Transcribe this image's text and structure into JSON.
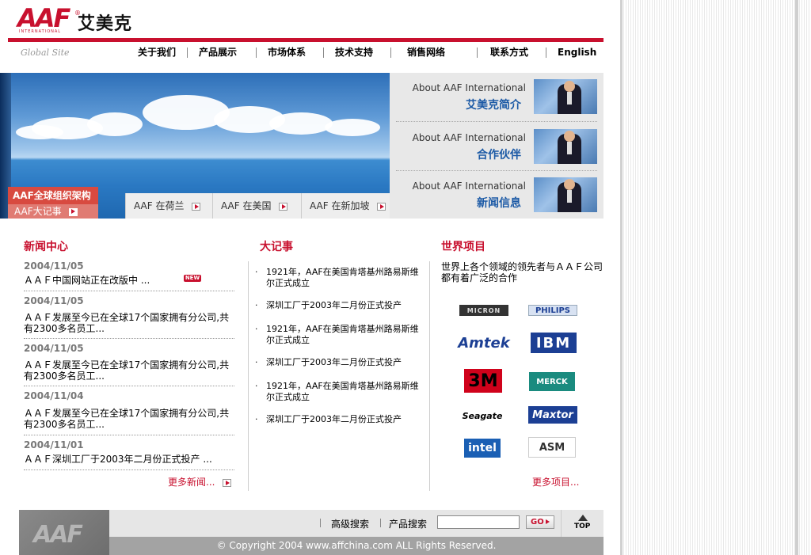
{
  "header": {
    "logo_text": "AAF",
    "logo_sub": "INTERNATIONAL",
    "logo_reg": "®",
    "brand_cn": "艾美克",
    "global_site": "Global Site"
  },
  "nav": [
    "关于我们",
    "产品展示",
    "市场体系",
    "技术支持",
    "销售网络",
    "联系方式",
    "English"
  ],
  "banner": {
    "caption_org": "AAF全球组织架构",
    "caption_events": "AAF大记事",
    "tabs": [
      "AAF 在荷兰",
      "AAF 在美国",
      "AAF 在新加坡"
    ],
    "side_items": [
      {
        "en": "About AAF International",
        "cn": "艾美克简介"
      },
      {
        "en": "About AAF International",
        "cn": "合作伙伴"
      },
      {
        "en": "About AAF International",
        "cn": "新闻信息"
      }
    ]
  },
  "news": {
    "title": "新闻中心",
    "badge": "NEW",
    "items": [
      {
        "date": "2004/11/05",
        "text": "ＡＡＦ中国网站正在改版中 ..."
      },
      {
        "date": "2004/11/05",
        "text": "ＡＡＦ发展至今已在全球17个国家拥有分公司,共有2300多名员工..."
      },
      {
        "date": "2004/11/05",
        "text": "ＡＡＦ发展至今已在全球17个国家拥有分公司,共有2300多名员工..."
      },
      {
        "date": "2004/11/04",
        "text": "ＡＡＦ发展至今已在全球17个国家拥有分公司,共有2300多名员工..."
      },
      {
        "date": "2004/11/01",
        "text": "ＡＡＦ深圳工厂于2003年二月份正式投产 ..."
      }
    ],
    "more": "更多新闻..."
  },
  "events": {
    "title": "大记事",
    "items": [
      "1921年，AAF在美国肯塔基州路易斯维尔正式成立",
      "深圳工厂于2003年二月份正式投产",
      "1921年，AAF在美国肯塔基州路易斯维尔正式成立",
      "深圳工厂于2003年二月份正式投产",
      "1921年，AAF在美国肯塔基州路易斯维尔正式成立",
      "深圳工厂于2003年二月份正式投产"
    ]
  },
  "projects": {
    "title": "世界项目",
    "intro": "世界上各个领域的领先者与ＡＡＦ公司都有着广泛的合作",
    "logos": [
      "MICRON",
      "PHILIPS",
      "Amtek",
      "IBM",
      "3M",
      "MERCK",
      "Seagate",
      "Maxtor",
      "intel",
      "ASM"
    ],
    "more": "更多项目..."
  },
  "footer": {
    "logo_text": "AAF",
    "advanced_search": "高级搜索",
    "product_search": "产品搜索",
    "search_value": "",
    "go": "GO",
    "top": "TOP",
    "copyright": "© Copyright 2004 www.affchina.com  ALL Rights Reserved."
  }
}
